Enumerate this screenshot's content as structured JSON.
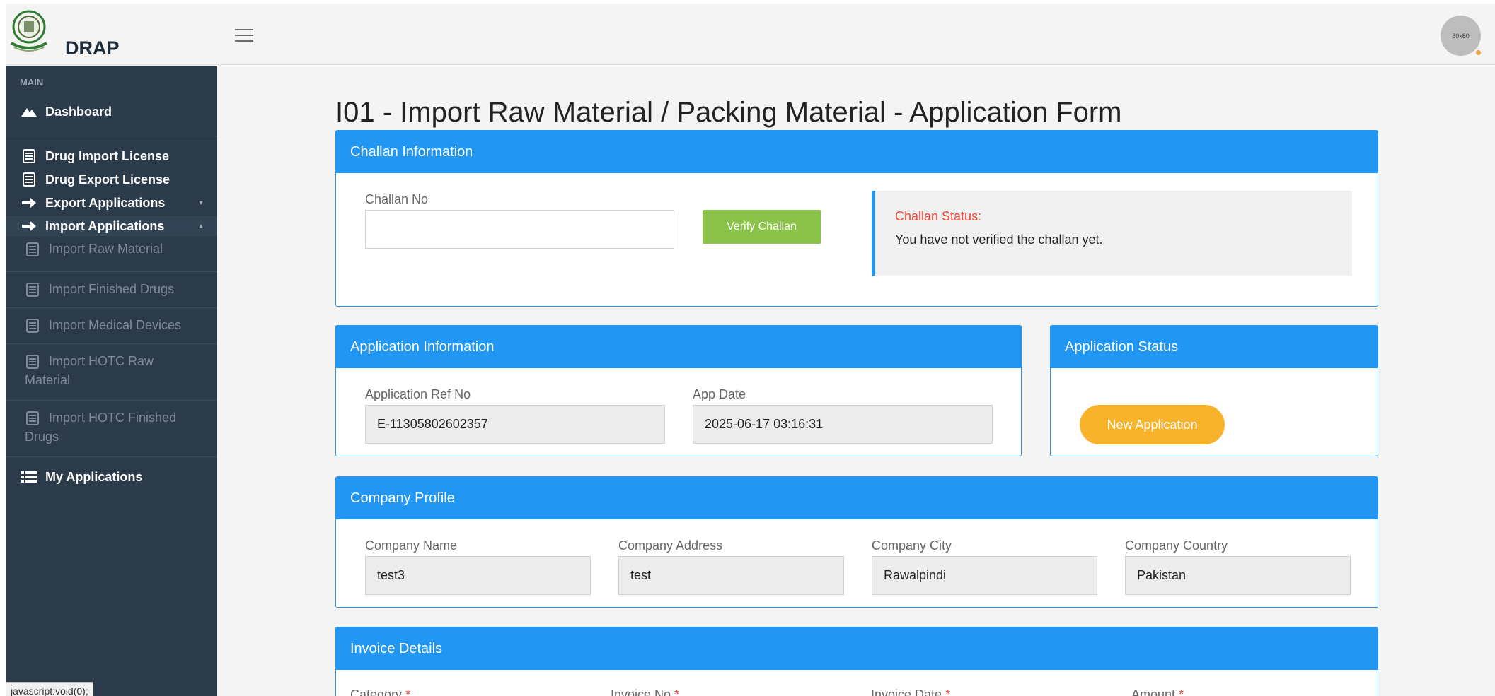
{
  "header": {
    "brand": "DRAP",
    "avatar_text": "80x80"
  },
  "sidebar": {
    "section": "MAIN",
    "dashboard": "Dashboard",
    "drug_import_license": "Drug Import License",
    "drug_export_license": "Drug Export License",
    "export_applications": "Export Applications",
    "import_applications": "Import Applications",
    "sub_items": [
      {
        "line1": "Import Raw Material",
        "line2": ""
      },
      {
        "line1": "Import Finished Drugs",
        "line2": ""
      },
      {
        "line1": "Import Medical Devices",
        "line2": ""
      },
      {
        "line1": "Import HOTC Raw",
        "line2": "Material"
      },
      {
        "line1": "Import HOTC Finished",
        "line2": "Drugs"
      }
    ],
    "my_applications": "My Applications"
  },
  "statusbar": "javascript:void(0);",
  "page_title": "I01 - Import Raw Material / Packing Material - Application Form",
  "challan": {
    "title": "Challan Information",
    "label": "Challan No",
    "value": "",
    "verify_button": "Verify Challan",
    "status_label": "Challan Status:",
    "status_text": "You have not verified the challan yet."
  },
  "application_info": {
    "title": "Application Information",
    "ref_label": "Application Ref No",
    "ref_value": "E-11305802602357",
    "date_label": "App Date",
    "date_value": "2025-06-17 03:16:31"
  },
  "application_status": {
    "title": "Application Status",
    "badge": "New Application"
  },
  "company": {
    "title": "Company Profile",
    "name_label": "Company Name",
    "name_value": "test3",
    "address_label": "Company Address",
    "address_value": "test",
    "city_label": "Company City",
    "city_value": "Rawalpindi",
    "country_label": "Company Country",
    "country_value": "Pakistan"
  },
  "invoice": {
    "title": "Invoice Details",
    "category_label": "Category",
    "invoice_no_label": "Invoice No",
    "invoice_date_label": "Invoice Date",
    "amount_label": "Amount",
    "required_mark": "*"
  },
  "colors": {
    "primary": "#2196f3",
    "sidebar": "#2b3b4a",
    "success": "#8bc34a",
    "warning": "#f9b32a",
    "danger": "#f44336"
  }
}
